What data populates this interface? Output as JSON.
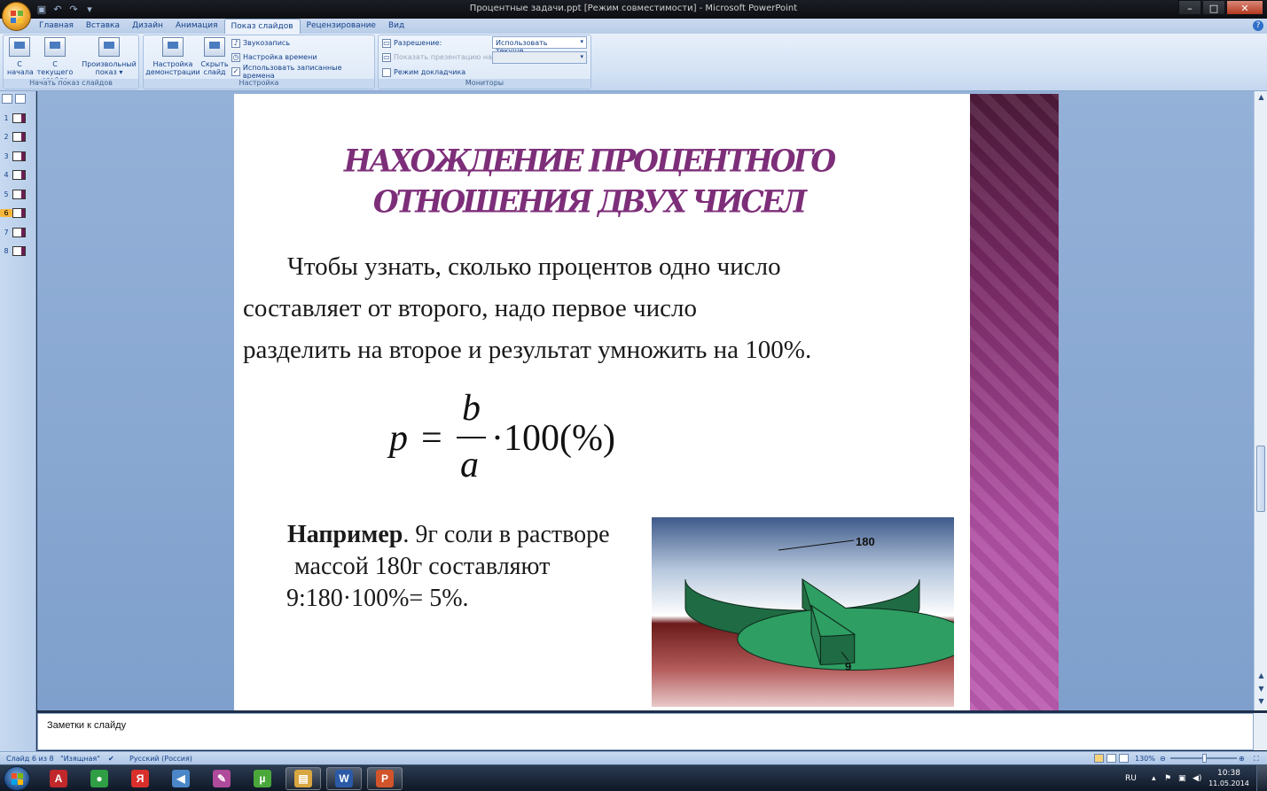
{
  "window": {
    "title": "Процентные задачи.ppt [Режим совместимости] - Microsoft PowerPoint",
    "controls": {
      "minimize": "–",
      "maximize": "□",
      "close": "✕"
    }
  },
  "quick_access": {
    "icons": [
      "save-icon",
      "undo-icon",
      "redo-icon",
      "customize-icon"
    ]
  },
  "tabs": [
    "Главная",
    "Вставка",
    "Дизайн",
    "Анимация",
    "Показ слайдов",
    "Рецензирование",
    "Вид"
  ],
  "active_tab": "Показ слайдов",
  "ribbon": {
    "group_start": {
      "label": "Начать показ слайдов",
      "from_start": "С\nначала",
      "from_start_l1": "С",
      "from_start_l2": "начала",
      "from_current_l1": "С текущего",
      "from_current_l2": "слайда",
      "custom_l1": "Произвольный",
      "custom_l2": "показ ▾"
    },
    "group_setup": {
      "label": "Настройка",
      "setup_l1": "Настройка",
      "setup_l2": "демонстрации",
      "hide_l1": "Скрыть",
      "hide_l2": "слайд",
      "record_narration": "Звукозапись",
      "rehearse_timings": "Настройка времени",
      "use_timings": "Использовать записанные времена",
      "use_timings_checked": true
    },
    "group_monitors": {
      "label": "Мониторы",
      "resolution_label": "Разрешение:",
      "resolution_value": "Использовать текуще...",
      "show_on_label": "Показать презентацию на:",
      "show_on_value": "",
      "presenter_view": "Режим докладчика",
      "presenter_view_checked": false
    }
  },
  "thumbnails": {
    "items": [
      "1",
      "2",
      "3",
      "4",
      "5",
      "6",
      "7",
      "8"
    ],
    "active": "6"
  },
  "slide": {
    "title_line1": "НАХОЖДЕНИЕ ПРОЦЕНТНОГО",
    "title_line2": "ОТНОШЕНИЯ ДВУХ ЧИСЕЛ",
    "title_color": "#7d2e79",
    "body_line1": "Чтобы узнать, сколько процентов одно число",
    "body_line2": "составляет от второго, надо первое число",
    "body_line3": "разделить на второе и результат умножить на 100%.",
    "formula": {
      "lhs": "p",
      "eq": "=",
      "numerator": "b",
      "denominator": "a",
      "rest": "·100(%)"
    },
    "example_bold": "Например",
    "example_line1_rest": ". 9г соли в растворе",
    "example_line2": "массой 180г составляют",
    "example_line3": "9:180·100%= 5%."
  },
  "chart_data": {
    "type": "pie",
    "categories": [
      "180",
      "9"
    ],
    "values": [
      180,
      9
    ],
    "data_labels": [
      "180",
      "9"
    ],
    "style": "3d-exploded",
    "colors": [
      "#2e9e63",
      "#2e9e63"
    ]
  },
  "notes": {
    "placeholder": "Заметки к слайду"
  },
  "status": {
    "slide_of": "Слайд 6 из 8",
    "theme": "\"Изящная\"",
    "language": "Русский (Россия)",
    "zoom": "130%"
  },
  "taskbar": {
    "apps": [
      {
        "name": "acrobat",
        "glyph": "A",
        "color": "#c0282c"
      },
      {
        "name": "chrome",
        "glyph": "●",
        "color": "#2f9e44"
      },
      {
        "name": "yandex",
        "glyph": "Я",
        "color": "#d9302c"
      },
      {
        "name": "vlc-audio",
        "glyph": "◀",
        "color": "#4a86c8"
      },
      {
        "name": "paint",
        "glyph": "✎",
        "color": "#b04a9a"
      },
      {
        "name": "utorrent",
        "glyph": "µ",
        "color": "#4aa83a"
      },
      {
        "name": "explorer",
        "glyph": "▤",
        "color": "#d8a640"
      },
      {
        "name": "word",
        "glyph": "W",
        "color": "#2b5aa8"
      },
      {
        "name": "powerpoint",
        "glyph": "P",
        "color": "#d2542a"
      }
    ],
    "lang": "RU",
    "time": "10:38",
    "date": "11.05.2014"
  }
}
